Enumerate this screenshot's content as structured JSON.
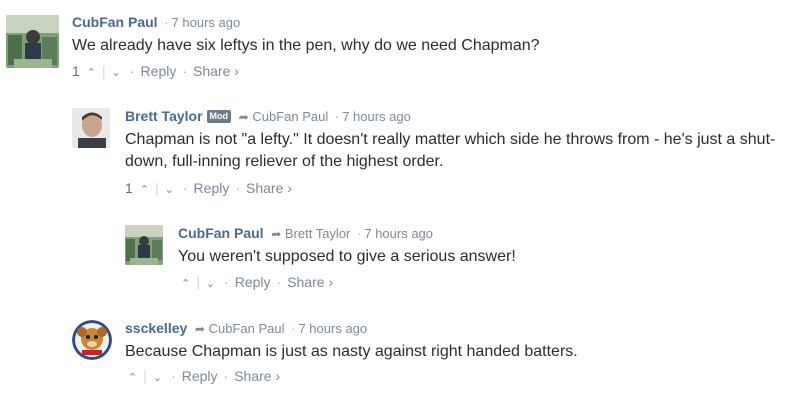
{
  "comments": [
    {
      "author": "CubFan Paul",
      "time": "7 hours ago",
      "body": "We already have six leftys in the pen, why do we need Chapman?",
      "upvotes": "1",
      "reply": "Reply",
      "share": "Share ›"
    },
    {
      "author": "Brett Taylor",
      "badge": "Mod",
      "parent": "CubFan Paul",
      "time": "7 hours ago",
      "body": "Chapman is not \"a lefty.\" It doesn't really matter which side he throws from - he's just a shut-down, full-inning reliever of the highest order.",
      "upvotes": "1",
      "reply": "Reply",
      "share": "Share ›"
    },
    {
      "author": "CubFan Paul",
      "parent": "Brett Taylor",
      "time": "7 hours ago",
      "body": "You weren't supposed to give a serious answer!",
      "reply": "Reply",
      "share": "Share ›"
    },
    {
      "author": "ssckelley",
      "parent": "CubFan Paul",
      "time": "7 hours ago",
      "body": "Because Chapman is just as nasty against right handed batters.",
      "reply": "Reply",
      "share": "Share ›"
    }
  ],
  "icons": {
    "up": "upvote-icon",
    "down": "downvote-icon",
    "reply_arrow": "reply-arrow-icon"
  }
}
